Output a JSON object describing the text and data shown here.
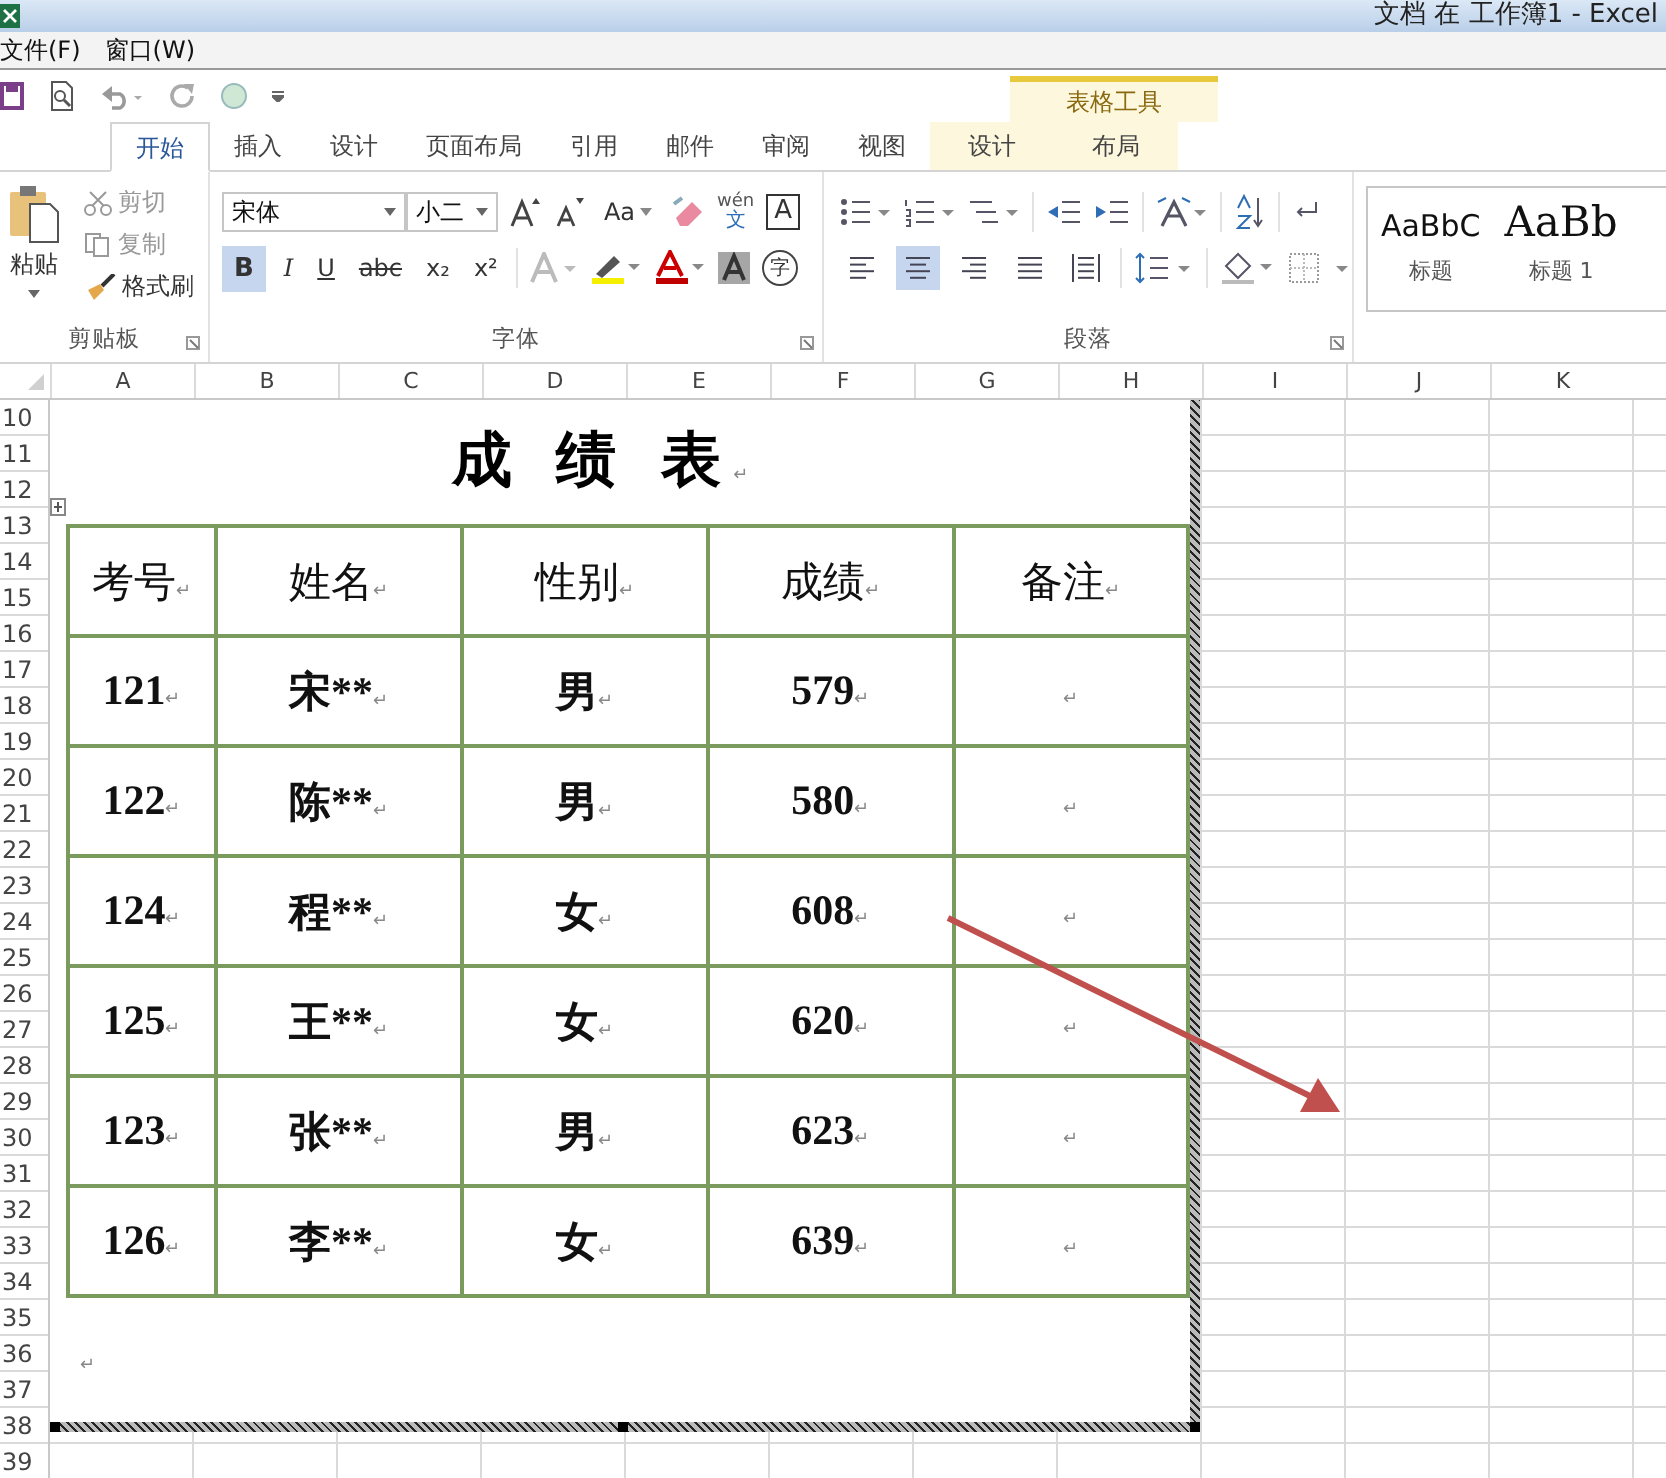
{
  "window": {
    "title": "文档 在 工作簿1 - Excel"
  },
  "menu": [
    "文件(F)",
    "窗口(W)"
  ],
  "contextual_tab_group": {
    "title": "表格工具"
  },
  "tabs": [
    {
      "label": "开始",
      "selected": true,
      "contextual": false
    },
    {
      "label": "插入",
      "selected": false,
      "contextual": false
    },
    {
      "label": "设计",
      "selected": false,
      "contextual": false
    },
    {
      "label": "页面布局",
      "selected": false,
      "contextual": false
    },
    {
      "label": "引用",
      "selected": false,
      "contextual": false
    },
    {
      "label": "邮件",
      "selected": false,
      "contextual": false
    },
    {
      "label": "审阅",
      "selected": false,
      "contextual": false
    },
    {
      "label": "视图",
      "selected": false,
      "contextual": false
    },
    {
      "label": "设计",
      "selected": false,
      "contextual": true
    },
    {
      "label": "布局",
      "selected": false,
      "contextual": true
    }
  ],
  "clipboard": {
    "paste": "粘贴",
    "cut": "剪切",
    "copy": "复制",
    "format_painter": "格式刷",
    "group": "剪贴板"
  },
  "font": {
    "name": "宋体",
    "size": "小二",
    "group": "字体",
    "case_button": "Aa",
    "phonetic": "wén",
    "phonetic_char": "文",
    "border_char": "A",
    "enclose_char": "字",
    "buttons": [
      {
        "label": "B",
        "kind": "bold",
        "selected": true
      },
      {
        "label": "I",
        "kind": "italic",
        "selected": false
      },
      {
        "label": "U",
        "kind": "underline",
        "selected": false
      },
      {
        "label": "abc",
        "kind": "strike",
        "selected": false
      },
      {
        "label": "x₂",
        "kind": "plain",
        "selected": false
      },
      {
        "label": "x²",
        "kind": "plain",
        "selected": false
      }
    ]
  },
  "paragraph": {
    "group": "段落",
    "alignments": [
      {
        "kind": "left",
        "selected": false
      },
      {
        "kind": "center",
        "selected": true
      },
      {
        "kind": "right",
        "selected": false
      },
      {
        "kind": "justify",
        "selected": false
      },
      {
        "kind": "distributed",
        "selected": false
      }
    ]
  },
  "styles": [
    {
      "sample": "AaBbC",
      "label": "标题",
      "kind": "sans"
    },
    {
      "sample": "AaBb",
      "label": "标题 1",
      "kind": "serif"
    }
  ],
  "columns": [
    "A",
    "B",
    "C",
    "D",
    "E",
    "F",
    "G",
    "H",
    "I",
    "J",
    "K"
  ],
  "rows": [
    "10",
    "11",
    "12",
    "13",
    "14",
    "15",
    "16",
    "17",
    "18",
    "19",
    "20",
    "21",
    "22",
    "23",
    "24",
    "25",
    "26",
    "27",
    "28",
    "29",
    "30",
    "31",
    "32",
    "33",
    "34",
    "35",
    "36",
    "37",
    "38",
    "39"
  ],
  "document": {
    "title": "成 绩 表",
    "title_mark": "↵",
    "end_mark": "↵",
    "header": [
      {
        "text": "考号",
        "mark": "↵"
      },
      {
        "text": "姓名",
        "mark": "↵"
      },
      {
        "text": "性别",
        "mark": "↵"
      },
      {
        "text": "成绩",
        "mark": "↵"
      },
      {
        "text": "备注",
        "mark": "↵"
      }
    ],
    "rows": [
      [
        {
          "text": "121",
          "mark": "↵"
        },
        {
          "text": "宋**",
          "mark": "↵"
        },
        {
          "text": "男",
          "mark": "↵"
        },
        {
          "text": "579",
          "mark": "↵"
        },
        {
          "text": "",
          "mark": "↵"
        }
      ],
      [
        {
          "text": "122",
          "mark": "↵"
        },
        {
          "text": "陈**",
          "mark": "↵"
        },
        {
          "text": "男",
          "mark": "↵"
        },
        {
          "text": "580",
          "mark": "↵"
        },
        {
          "text": "",
          "mark": "↵"
        }
      ],
      [
        {
          "text": "124",
          "mark": "↵"
        },
        {
          "text": "程**",
          "mark": "↵"
        },
        {
          "text": "女",
          "mark": "↵"
        },
        {
          "text": "608",
          "mark": "↵"
        },
        {
          "text": "",
          "mark": "↵"
        }
      ],
      [
        {
          "text": "125",
          "mark": "↵"
        },
        {
          "text": "王**",
          "mark": "↵"
        },
        {
          "text": "女",
          "mark": "↵"
        },
        {
          "text": "620",
          "mark": "↵"
        },
        {
          "text": "",
          "mark": "↵"
        }
      ],
      [
        {
          "text": "123",
          "mark": "↵"
        },
        {
          "text": "张**",
          "mark": "↵"
        },
        {
          "text": "男",
          "mark": "↵"
        },
        {
          "text": "623",
          "mark": "↵"
        },
        {
          "text": "",
          "mark": "↵"
        }
      ],
      [
        {
          "text": "126",
          "mark": "↵"
        },
        {
          "text": "李**",
          "mark": "↵"
        },
        {
          "text": "女",
          "mark": "↵"
        },
        {
          "text": "639",
          "mark": "↵"
        },
        {
          "text": "",
          "mark": "↵"
        }
      ]
    ]
  }
}
